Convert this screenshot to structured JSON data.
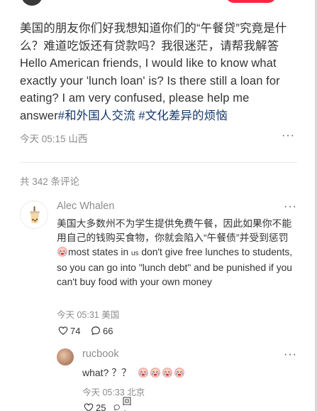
{
  "post": {
    "text": "美国的朋友你们好我想知道你们的“午餐贷”究竟是什么？难道吃饭还有贷款吗？我很迷茫，请帮我解答Hello American friends, I would like to know what exactly your 'lunch loan' is? Is there still a loan for eating? I am very confused, please help me answer",
    "tags": [
      "#和外国人交流",
      "#文化差异的烦恼"
    ],
    "date": "今天 05:15",
    "location": "山西",
    "more_label": "···"
  },
  "comments_header": {
    "count_text": "共 342 条评论"
  },
  "comments": [
    {
      "username": "Alec Whalen",
      "text_cn": "美国大多数州不为学生提供免费午餐，因此如果你不能用自己的钱购买食物，你就会陷入“午餐债”并受到惩罚",
      "us_mark": "us",
      "text_en_before": "most states in ",
      "text_en_after": " don't give free lunches to students, so you can go into \"lunch debt\" and be punished if you can't buy food with your own money",
      "date": "今天 05:31",
      "location": "美国",
      "likes": "74",
      "replies": "66",
      "avatar_icon": "bubble-tea-icon",
      "more_label": "···"
    },
    {
      "username": "rucbook",
      "text": "what? ？？",
      "emoji_icon": "crying-face-icon",
      "emoji_count": 4,
      "date": "今天 05:33",
      "location": "北京",
      "likes": "25",
      "reply_label": "回复",
      "more_label": "···"
    }
  ],
  "colors": {
    "tag": "#13386c",
    "meta_gray": "#8c8c8c",
    "follow_red": "#ff2442"
  }
}
